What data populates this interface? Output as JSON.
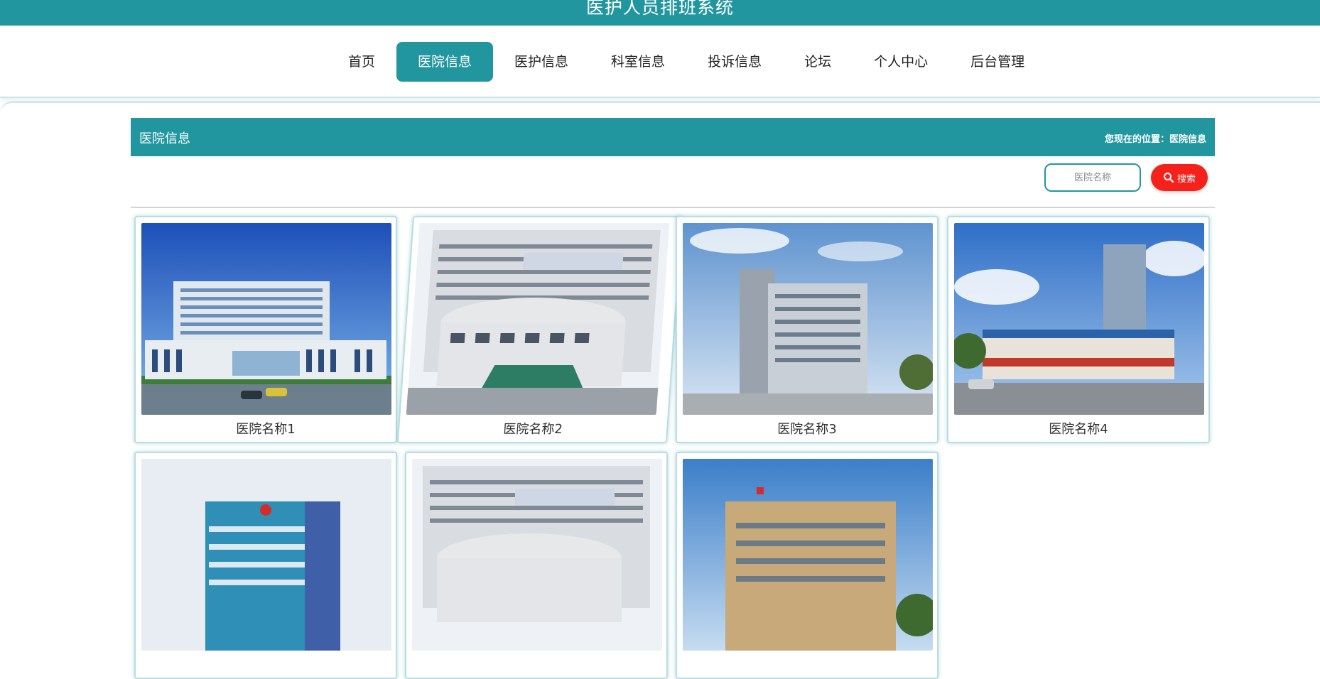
{
  "header": {
    "site_title": "医护人员排班系统"
  },
  "nav": {
    "items": [
      {
        "label": "首页",
        "active": false
      },
      {
        "label": "医院信息",
        "active": true
      },
      {
        "label": "医护信息",
        "active": false
      },
      {
        "label": "科室信息",
        "active": false
      },
      {
        "label": "投诉信息",
        "active": false
      },
      {
        "label": "论坛",
        "active": false
      },
      {
        "label": "个人中心",
        "active": false
      },
      {
        "label": "后台管理",
        "active": false
      }
    ]
  },
  "section": {
    "title": "医院信息",
    "breadcrumb_prefix": "您现在的位置：",
    "breadcrumb_current": "医院信息"
  },
  "search": {
    "placeholder": "医院名称",
    "button_label": "搜索",
    "icon": "search-icon"
  },
  "hospitals": [
    {
      "name": "医院名称1"
    },
    {
      "name": "医院名称2"
    },
    {
      "name": "医院名称3"
    },
    {
      "name": "医院名称4"
    },
    {
      "name": ""
    },
    {
      "name": ""
    },
    {
      "name": ""
    }
  ],
  "colors": {
    "brand": "#22969f",
    "search_button": "#f5221b"
  }
}
